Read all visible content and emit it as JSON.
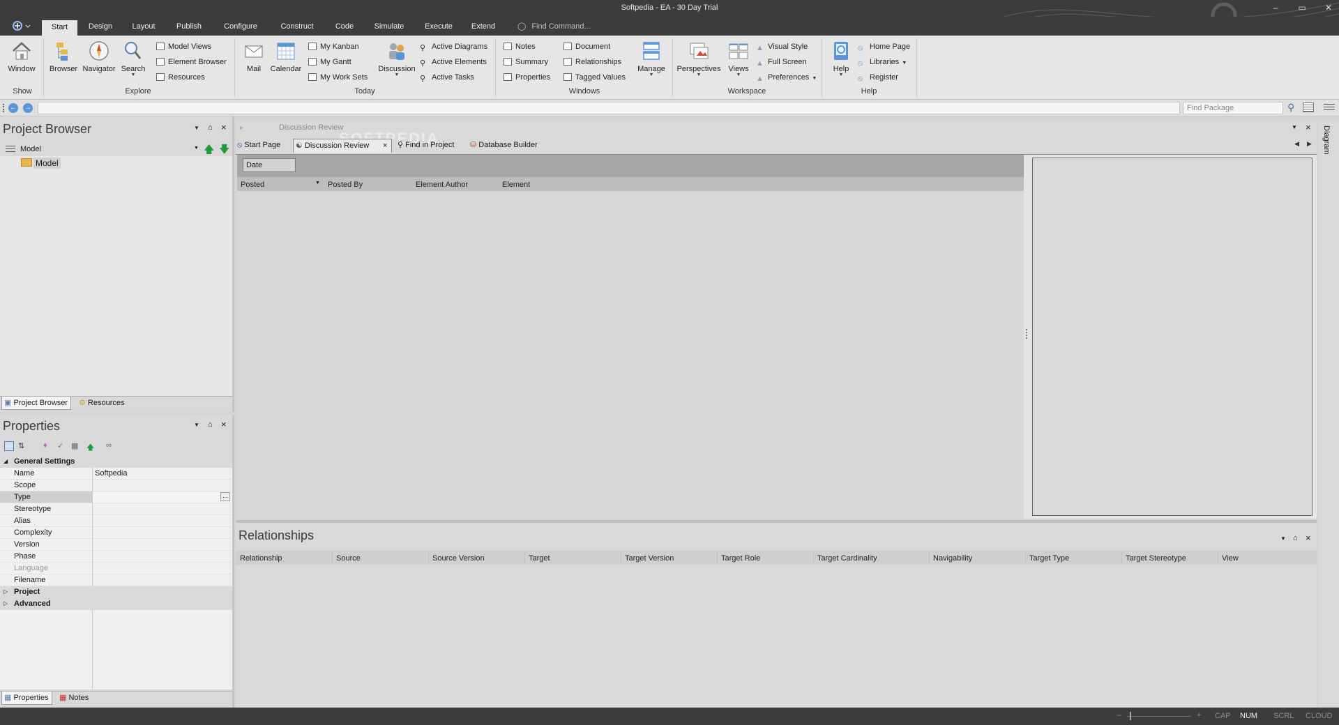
{
  "window": {
    "title": "Softpedia - EA - 30 Day Trial",
    "minimize": "–",
    "restore": "▭",
    "close": "✕"
  },
  "menu": {
    "tabs": [
      "Start",
      "Design",
      "Layout",
      "Publish",
      "Configure",
      "Construct",
      "Code",
      "Simulate",
      "Execute",
      "Extend"
    ],
    "active_tab": "Start",
    "find_command": "Find Command..."
  },
  "ribbon": {
    "show": {
      "label": "Show",
      "window": "Window"
    },
    "explore": {
      "label": "Explore",
      "browser": "Browser",
      "navigator": "Navigator",
      "search": "Search",
      "model_views": "Model Views",
      "element_browser": "Element Browser",
      "resources": "Resources"
    },
    "today": {
      "label": "Today",
      "mail": "Mail",
      "calendar": "Calendar",
      "my_kanban": "My Kanban",
      "my_gantt": "My Gantt",
      "my_work_sets": "My Work Sets",
      "discussion": "Discussion",
      "active_diagrams": "Active Diagrams",
      "active_elements": "Active Elements",
      "active_tasks": "Active Tasks"
    },
    "windows": {
      "label": "Windows",
      "notes": "Notes",
      "summary": "Summary",
      "properties": "Properties",
      "document": "Document",
      "relationships": "Relationships",
      "tagged_values": "Tagged Values",
      "manage": "Manage"
    },
    "workspace": {
      "label": "Workspace",
      "perspectives": "Perspectives",
      "views": "Views",
      "visual_style": "Visual Style",
      "full_screen": "Full Screen",
      "preferences": "Preferences"
    },
    "help": {
      "label": "Help",
      "help": "Help",
      "home_page": "Home Page",
      "libraries": "Libraries",
      "register": "Register"
    }
  },
  "navbar": {
    "find_package_placeholder": "Find Package"
  },
  "project_browser": {
    "title": "Project Browser",
    "root": "Model",
    "node": "Model",
    "tabs": [
      "Project Browser",
      "Resources"
    ]
  },
  "properties": {
    "title": "Properties",
    "section": "General Settings",
    "rows": [
      {
        "key": "Name",
        "value": "Softpedia"
      },
      {
        "key": "Scope",
        "value": ""
      },
      {
        "key": "Type",
        "value": ""
      },
      {
        "key": "Stereotype",
        "value": ""
      },
      {
        "key": "Alias",
        "value": ""
      },
      {
        "key": "Complexity",
        "value": ""
      },
      {
        "key": "Version",
        "value": ""
      },
      {
        "key": "Phase",
        "value": ""
      },
      {
        "key": "Language",
        "value": ""
      },
      {
        "key": "Filename",
        "value": ""
      }
    ],
    "collapsed_sections": [
      "Project",
      "Advanced"
    ],
    "tabs": [
      "Properties",
      "Notes"
    ],
    "ellipsis": "..."
  },
  "document": {
    "header": "Discussion Review",
    "watermark": "SOFTPEDIA",
    "tabs": [
      "Start Page",
      "Discussion Review",
      "Find in Project",
      "Database Builder"
    ],
    "active_tab": "Discussion Review",
    "filter_value": "Date",
    "columns": [
      "Posted",
      "Posted By",
      "Element Author",
      "Element"
    ]
  },
  "side_tab": "Diagram",
  "relationships": {
    "title": "Relationships",
    "columns": [
      "Relationship",
      "Source",
      "Source Version",
      "Target",
      "Target Version",
      "Target Role",
      "Target Cardinality",
      "Navigability",
      "Target Type",
      "Target Stereotype",
      "View"
    ]
  },
  "status": {
    "minus": "–",
    "plus": "+",
    "cap": "CAP",
    "num": "NUM",
    "scrl": "SCRL",
    "cloud": "CLOUD"
  }
}
